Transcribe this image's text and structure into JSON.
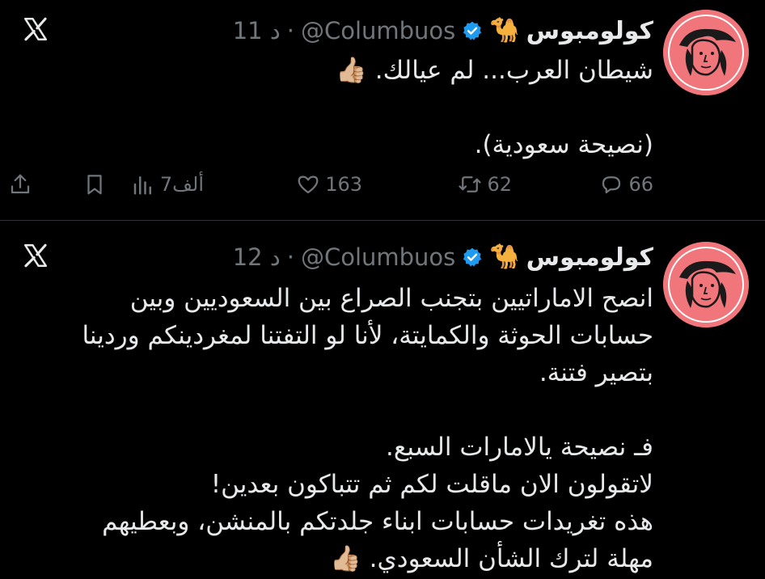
{
  "tweets": [
    {
      "author_name": "كولومبوس",
      "author_emoji": "🐪",
      "handle": "@Columbuos",
      "separator": "·",
      "time": "11 د",
      "body_lines": [
        "شيطان العرب... لم عيالك. 👍🏼",
        "",
        "(نصيحة سعودية)."
      ],
      "replies": "66",
      "retweets": "62",
      "likes": "163",
      "views": "7ألف"
    },
    {
      "author_name": "كولومبوس",
      "author_emoji": "🐪",
      "handle": "@Columbuos",
      "separator": "·",
      "time": "12 د",
      "body_lines": [
        "انصح الاماراتيين بتجنب الصراع بين السعوديين وبين",
        "حسابات الحوثة والكمايتة، لأنا لو التفتنا لمغردينكم وردينا",
        "بتصير فتنة.",
        "",
        "فـ نصيحة يالامارات السبع.",
        "لاتقولون الان ماقلت لكم ثم تتباكون بعدين!",
        "هذه تغريدات حسابات ابناء جلدتكم بالمنشن، وبعطيهم",
        "مهلة لترك الشأن السعودي. 👍🏼"
      ]
    }
  ],
  "colors": {
    "background": "#000000",
    "text": "#e7e9ea",
    "muted": "#71767b",
    "verified": "#1d9bf0",
    "avatar_bg": "#f0767c"
  },
  "icons": [
    "x-logo-icon",
    "verified-badge-icon",
    "reply-icon",
    "retweet-icon",
    "like-icon",
    "views-icon",
    "bookmark-icon",
    "share-icon"
  ]
}
